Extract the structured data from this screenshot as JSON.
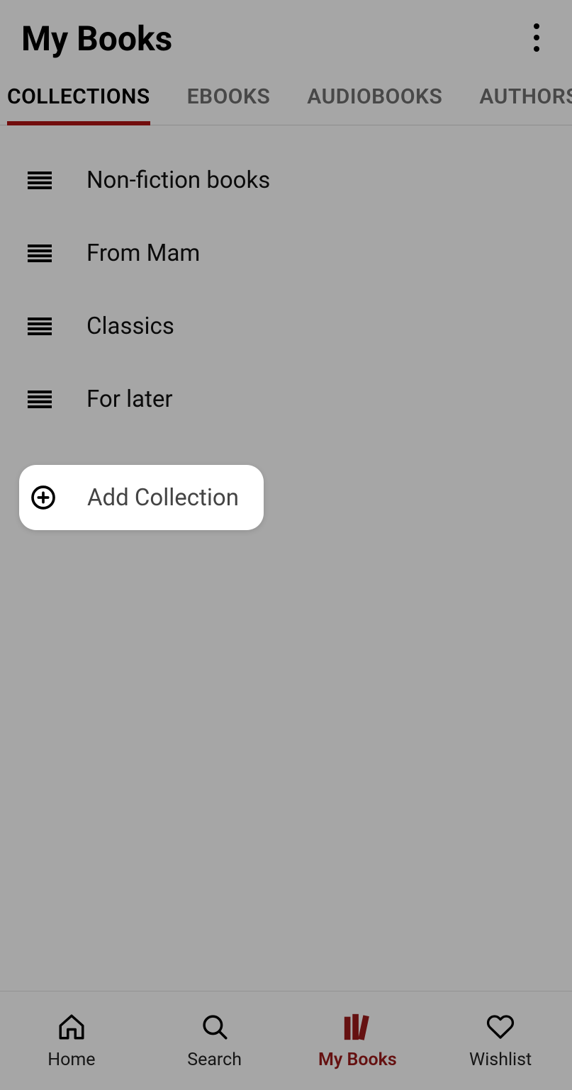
{
  "header": {
    "title": "My Books"
  },
  "tabs": [
    {
      "label": "COLLECTIONS",
      "active": true
    },
    {
      "label": "EBOOKS",
      "active": false
    },
    {
      "label": "AUDIOBOOKS",
      "active": false
    },
    {
      "label": "AUTHORS",
      "active": false
    }
  ],
  "collections": [
    {
      "label": "Non-fiction books"
    },
    {
      "label": "From Mam"
    },
    {
      "label": "Classics"
    },
    {
      "label": "For later"
    }
  ],
  "add_collection": {
    "label": "Add Collection"
  },
  "bottom_nav": [
    {
      "label": "Home",
      "icon": "home-icon",
      "active": false
    },
    {
      "label": "Search",
      "icon": "search-icon",
      "active": false
    },
    {
      "label": "My Books",
      "icon": "books-icon",
      "active": true
    },
    {
      "label": "Wishlist",
      "icon": "heart-icon",
      "active": false
    }
  ],
  "colors": {
    "accent": "#9b1b1b",
    "tab_underline": "#b01515"
  }
}
